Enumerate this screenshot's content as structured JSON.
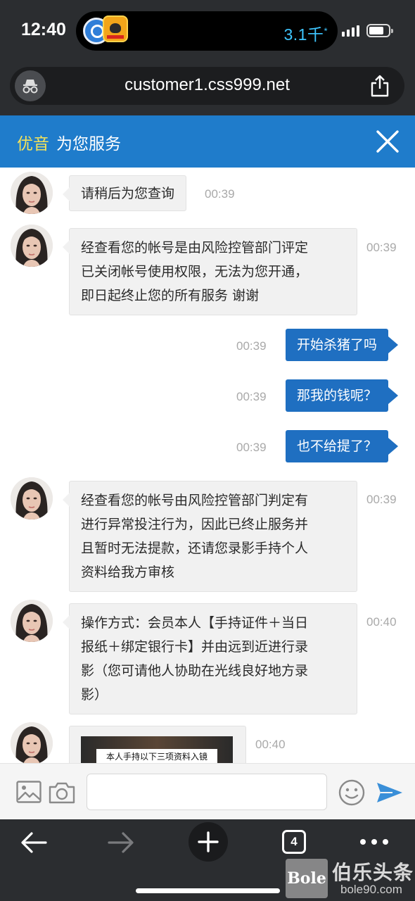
{
  "status_bar": {
    "time": "12:40",
    "network_speed": "3.1千",
    "speed_unit_glyph": "*"
  },
  "browser": {
    "url": "customer1.css999.net",
    "open_tabs": "4"
  },
  "chat_header": {
    "brand": "优音",
    "title": "为您服务"
  },
  "messages": [
    {
      "from": "agent",
      "text": "请稍后为您查询",
      "time": "00:39"
    },
    {
      "from": "agent",
      "lines": [
        "经查看您的帐号是由风险控管部门评定",
        "已关闭帐号使用权限，无法为您开通，",
        "即日起终止您的所有服务 谢谢"
      ],
      "time": "00:39"
    },
    {
      "from": "user",
      "text": "开始杀猪了吗",
      "time": "00:39"
    },
    {
      "from": "user",
      "text": "那我的钱呢？",
      "time": "00:39"
    },
    {
      "from": "user",
      "text": "也不给提了？",
      "time": "00:39"
    },
    {
      "from": "agent",
      "lines": [
        "经查看您的帐号由风险控管部门判定有",
        "进行异常投注行为，因此已终止服务并",
        "且暂时无法提款，还请您录影手持个人",
        "资料给我方审核"
      ],
      "time": "00:39"
    },
    {
      "from": "agent",
      "lines": [
        "操作方式：会员本人【手持证件＋当日",
        "报纸＋绑定银行卡】并由远到近进行录",
        "影（您可请他人协助在光线良好地方录",
        "影）"
      ],
      "time": "00:40"
    },
    {
      "from": "agent",
      "image_caption": "本人手持以下三项资料入镜",
      "time": "00:40"
    }
  ],
  "composer": {
    "placeholder": ""
  },
  "watermark": {
    "logo": "Bole",
    "name": "伯乐头条",
    "url": "bole90.com"
  },
  "colors": {
    "header_blue": "#1f7ccb",
    "brand_yellow": "#f5e35a",
    "outgoing_bubble": "#1f6fc1",
    "incoming_bubble": "#f1f1f1",
    "browser_chrome": "#2b2d30",
    "speed_cyan": "#3ec6ff",
    "send_blue": "#3a8fd8"
  },
  "icons": [
    "incognito-icon",
    "share-icon",
    "close-icon",
    "image-icon",
    "camera-icon",
    "emoji-icon",
    "send-icon",
    "back-icon",
    "forward-icon",
    "plus-icon",
    "more-icon"
  ]
}
